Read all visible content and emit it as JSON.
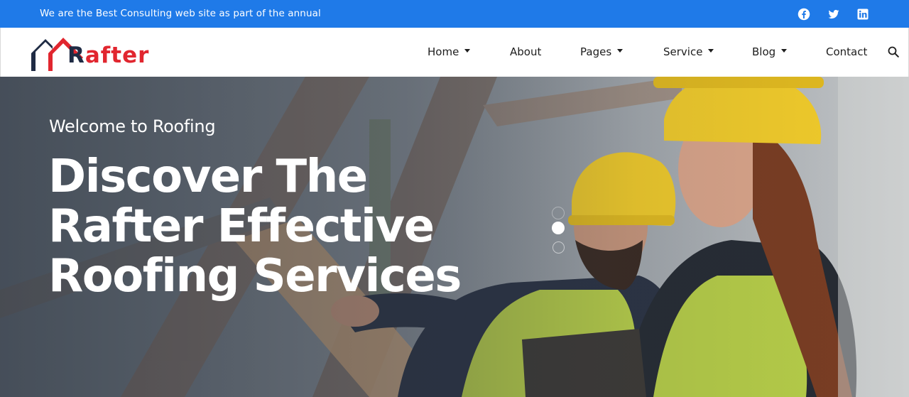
{
  "topbar": {
    "text": "We are the Best Consulting web site as part of the annual",
    "background": "#1f7ae8",
    "social": [
      "facebook-icon",
      "twitter-icon",
      "linkedin-icon"
    ]
  },
  "header": {
    "logo": {
      "first_letter": "R",
      "rest": "after",
      "primary": "#1f2b44",
      "accent": "#e1262f"
    },
    "nav": [
      {
        "label": "Home",
        "dropdown": true
      },
      {
        "label": "About",
        "dropdown": false
      },
      {
        "label": "Pages",
        "dropdown": true
      },
      {
        "label": "Service",
        "dropdown": true
      },
      {
        "label": "Blog",
        "dropdown": true
      },
      {
        "label": "Contact",
        "dropdown": false
      }
    ],
    "search_icon": "search-icon"
  },
  "hero": {
    "subtitle": "Welcome to Roofing",
    "title_lines": [
      "Discover The",
      "Rafter Effective",
      "Roofing Services"
    ],
    "slides": {
      "count": 3,
      "active": 2
    }
  }
}
